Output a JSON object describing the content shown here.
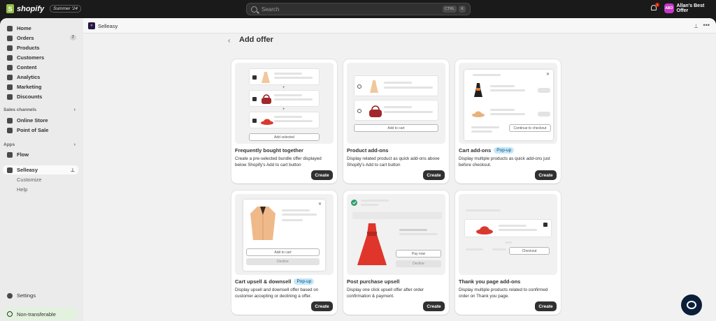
{
  "topbar": {
    "logo_text": "shopify",
    "edition": "Summer '24",
    "search_placeholder": "Search",
    "shortcut_ctrl": "CTRL",
    "shortcut_k": "K",
    "notification_count": "1",
    "store_initials": "ABO",
    "store_name": "Allan's Best Offer"
  },
  "sidebar": {
    "items": [
      {
        "label": "Home",
        "icon": "home-icon"
      },
      {
        "label": "Orders",
        "icon": "orders-icon",
        "count": "7"
      },
      {
        "label": "Products",
        "icon": "tag-icon"
      },
      {
        "label": "Customers",
        "icon": "person-icon"
      },
      {
        "label": "Content",
        "icon": "content-icon"
      },
      {
        "label": "Analytics",
        "icon": "chart-icon"
      },
      {
        "label": "Marketing",
        "icon": "target-icon"
      },
      {
        "label": "Discounts",
        "icon": "discount-icon"
      }
    ],
    "sales_channels_label": "Sales channels",
    "sales_channels": [
      {
        "label": "Online Store",
        "icon": "store-icon"
      },
      {
        "label": "Point of Sale",
        "icon": "pos-icon"
      }
    ],
    "apps_label": "Apps",
    "apps": [
      {
        "label": "Flow",
        "icon": "flow-icon"
      },
      {
        "label": "Selleasy",
        "icon": "selleasy-icon"
      }
    ],
    "app_sub": [
      "Customize",
      "Help"
    ],
    "settings_label": "Settings",
    "non_transferable": "Non-transferable"
  },
  "appbar": {
    "app_name": "Selleasy"
  },
  "page": {
    "back_icon": "‹",
    "title": "Add offer"
  },
  "cards": [
    {
      "title": "Frequently bought together",
      "badge": "",
      "desc": "Create a pre-selected bundle offer displayed below Shopify's Add to cart button",
      "button": "Create",
      "preview_button": "Add selected"
    },
    {
      "title": "Product add-ons",
      "badge": "",
      "desc": "Display related product as quick add-ons above Shopify's Add to cart button",
      "button": "Create",
      "preview_button": "Add to cart"
    },
    {
      "title": "Cart add-ons",
      "badge": "Pop-up",
      "desc": "Display multiple products as quick add-ons just before checkout.",
      "button": "Create",
      "preview_button": "Continue to checkout"
    },
    {
      "title": "Cart upsell & downsell",
      "badge": "Pop-up",
      "desc": "Display upsell and downsell offer based on customer accepting or declining a offer.",
      "button": "Create",
      "preview_button": "Add to cart",
      "preview_button2": "Decline"
    },
    {
      "title": "Post purchase upsell",
      "badge": "",
      "desc": "Display one click upsell offer after order confirmation & payment.",
      "button": "Create",
      "preview_button": "Pay now",
      "preview_button2": "Decline"
    },
    {
      "title": "Thank you page add-ons",
      "badge": "",
      "desc": "Display multiple products related to confirmed order on Thank you page.",
      "button": "Create",
      "preview_button": "Checkout"
    }
  ]
}
